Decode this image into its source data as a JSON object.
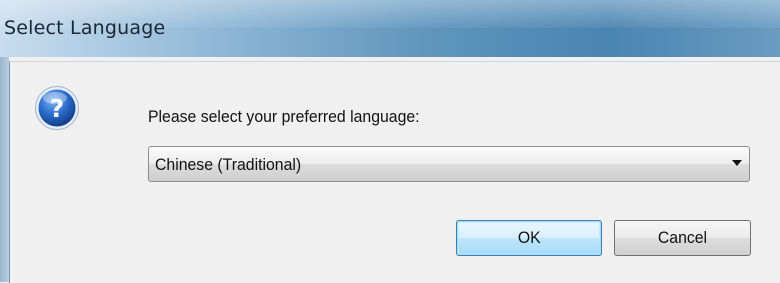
{
  "window": {
    "title": "Select Language"
  },
  "dialog": {
    "icon": "question-icon",
    "prompt": "Please select your preferred language:",
    "language_select": {
      "selected": "Chinese (Traditional)"
    },
    "buttons": {
      "ok": "OK",
      "cancel": "Cancel"
    }
  },
  "colors": {
    "titlebar_start": "#c8ddef",
    "titlebar_end": "#4a84b1",
    "focus_border": "#3c7fb1",
    "icon_blue": "#1f5fb8"
  }
}
